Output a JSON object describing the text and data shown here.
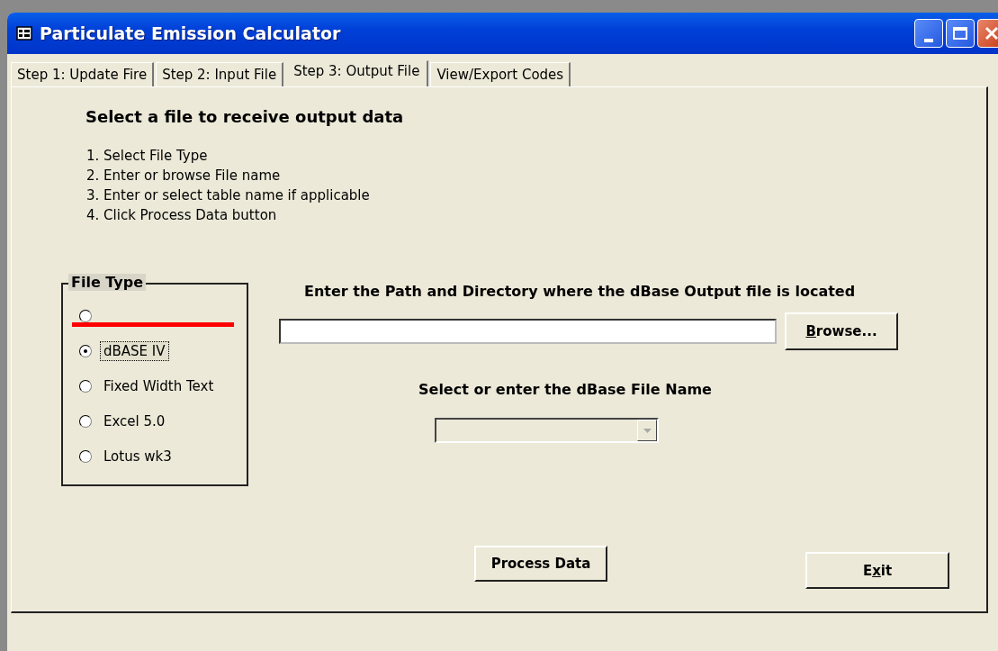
{
  "window": {
    "title": "Particulate Emission Calculator"
  },
  "tabs": [
    {
      "label": "Step 1: Update Fire",
      "selected": false
    },
    {
      "label": "Step 2: Input File",
      "selected": false
    },
    {
      "label": "Step 3: Output File",
      "selected": true
    },
    {
      "label": "View/Export Codes",
      "selected": false
    }
  ],
  "heading": "Select a file to receive output data",
  "instructions": [
    "1. Select File Type",
    "2. Enter or browse File name",
    "3. Enter or select table name if applicable",
    "4. Click Process Data button"
  ],
  "file_type": {
    "title": "File Type",
    "options": [
      {
        "selected": false,
        "struck_out": true,
        "focused": false
      },
      {
        "label": "dBASE IV",
        "selected": true,
        "struck_out": false,
        "focused": true
      },
      {
        "label": "Fixed Width Text",
        "selected": false,
        "struck_out": false,
        "focused": false
      },
      {
        "label": "Excel 5.0",
        "selected": false,
        "struck_out": false,
        "focused": false
      },
      {
        "label": "Lotus wk3",
        "selected": false,
        "struck_out": false,
        "focused": false
      }
    ]
  },
  "path_label": "Enter the Path and Directory where the dBase Output file is located",
  "browse_button": {
    "key": "B",
    "after": "rowse..."
  },
  "file_name_label": "Select or enter the dBase File Name",
  "file_name_combo": {
    "disabled": true
  },
  "process_button": {
    "before": "Process Data"
  },
  "exit_button": {
    "before": "E",
    "key": "x",
    "after": "it"
  }
}
